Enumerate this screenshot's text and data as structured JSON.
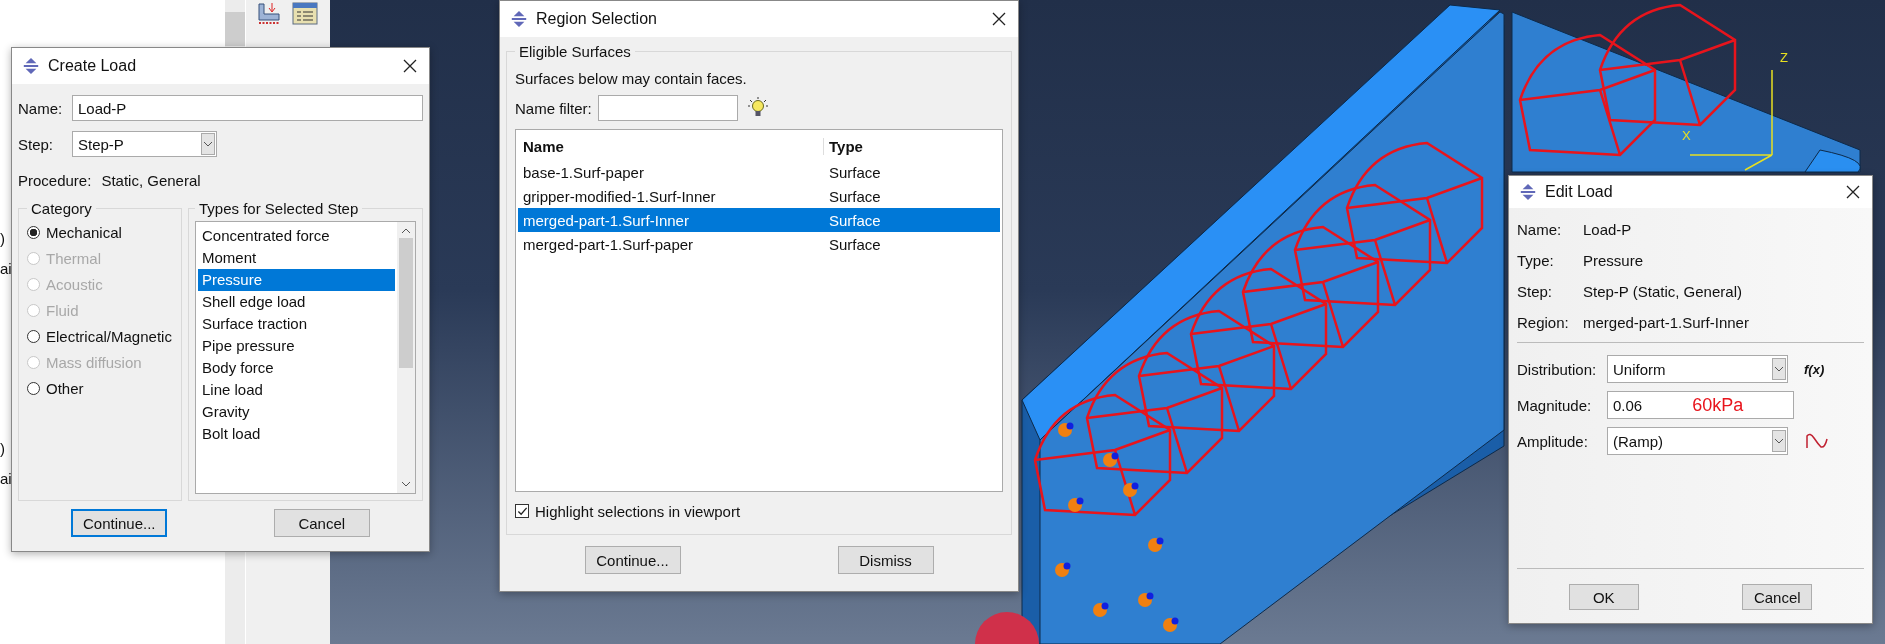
{
  "background_panel": {
    "fragments": [
      ")",
      "ai",
      ")",
      "ai"
    ]
  },
  "create_load": {
    "title": "Create Load",
    "name_label": "Name:",
    "name_value": "Load-P",
    "step_label": "Step:",
    "step_value": "Step-P",
    "procedure_label": "Procedure:",
    "procedure_value": "Static, General",
    "category_title": "Category",
    "categories": [
      {
        "label": "Mechanical",
        "selected": true,
        "disabled": false
      },
      {
        "label": "Thermal",
        "selected": false,
        "disabled": true
      },
      {
        "label": "Acoustic",
        "selected": false,
        "disabled": true
      },
      {
        "label": "Fluid",
        "selected": false,
        "disabled": true
      },
      {
        "label": "Electrical/Magnetic",
        "selected": false,
        "disabled": false
      },
      {
        "label": "Mass diffusion",
        "selected": false,
        "disabled": true
      },
      {
        "label": "Other",
        "selected": false,
        "disabled": false
      }
    ],
    "types_title": "Types for Selected Step",
    "types": [
      {
        "label": "Concentrated force",
        "selected": false
      },
      {
        "label": "Moment",
        "selected": false
      },
      {
        "label": "Pressure",
        "selected": true
      },
      {
        "label": "Shell edge load",
        "selected": false
      },
      {
        "label": "Surface traction",
        "selected": false
      },
      {
        "label": "Pipe pressure",
        "selected": false
      },
      {
        "label": "Body force",
        "selected": false
      },
      {
        "label": "Line load",
        "selected": false
      },
      {
        "label": "Gravity",
        "selected": false
      },
      {
        "label": "Bolt load",
        "selected": false
      }
    ],
    "buttons": [
      {
        "label": "Continue...",
        "default": true
      },
      {
        "label": "Cancel",
        "default": false
      }
    ]
  },
  "region_selection": {
    "title": "Region Selection",
    "group_title": "Eligible Surfaces",
    "hint": "Surfaces below may contain faces.",
    "filter_label": "Name filter:",
    "columns": [
      "Name",
      "Type"
    ],
    "rows": [
      {
        "name": "base-1.Surf-paper",
        "type": "Surface",
        "selected": false
      },
      {
        "name": "gripper-modified-1.Surf-Inner",
        "type": "Surface",
        "selected": false
      },
      {
        "name": "merged-part-1.Surf-Inner",
        "type": "Surface",
        "selected": true
      },
      {
        "name": "merged-part-1.Surf-paper",
        "type": "Surface",
        "selected": false
      }
    ],
    "highlight": {
      "label": "Highlight selections in viewport",
      "checked": true
    },
    "buttons": [
      "Continue...",
      "Dismiss"
    ]
  },
  "edit_load": {
    "title": "Edit Load",
    "info": [
      {
        "label": "Name:",
        "value": "Load-P"
      },
      {
        "label": "Type:",
        "value": "Pressure"
      },
      {
        "label": "Step:",
        "value": "Step-P (Static, General)"
      },
      {
        "label": "Region:",
        "value": "merged-part-1.Surf-Inner"
      }
    ],
    "fields": [
      {
        "kind": "select",
        "label": "Distribution:",
        "value": "Uniform",
        "side": {
          "kind": "text",
          "text": "f(x)"
        }
      },
      {
        "kind": "input",
        "label": "Magnitude:",
        "value": "0.06",
        "note": "60kPa"
      },
      {
        "kind": "select",
        "label": "Amplitude:",
        "value": "(Ramp)",
        "side": {
          "kind": "wave"
        }
      }
    ],
    "buttons": [
      "OK",
      "Cancel"
    ]
  },
  "viewport": {
    "axes": [
      {
        "label": "Z"
      },
      {
        "label": "X"
      }
    ]
  }
}
